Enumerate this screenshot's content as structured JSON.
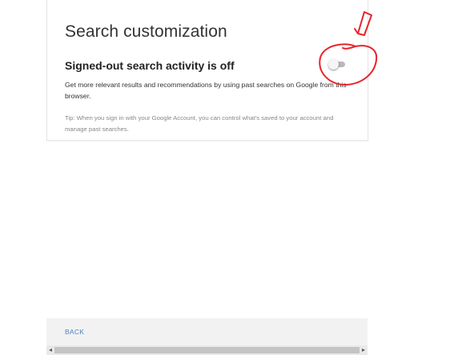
{
  "page_title": "Search customization",
  "setting": {
    "heading": "Signed-out search activity is off",
    "description": "Get more relevant results and recommendations by using past searches on Google from this browser.",
    "tip_label": "Tip:",
    "tip_text": " When you sign in with your Google Account, you can control what's saved to your account and manage past searches.",
    "toggle_state": "off"
  },
  "footer": {
    "back_label": "BACK"
  },
  "scrollbar": {
    "left_arrow": "◂",
    "right_arrow": "▸"
  },
  "annotation": {
    "color": "#e8232a",
    "shapes": [
      "arrow",
      "circle"
    ]
  },
  "colors": {
    "link": "#4d86c6",
    "toggle_off_track": "#b9b9b9",
    "footer_bg": "#f2f2f2"
  }
}
